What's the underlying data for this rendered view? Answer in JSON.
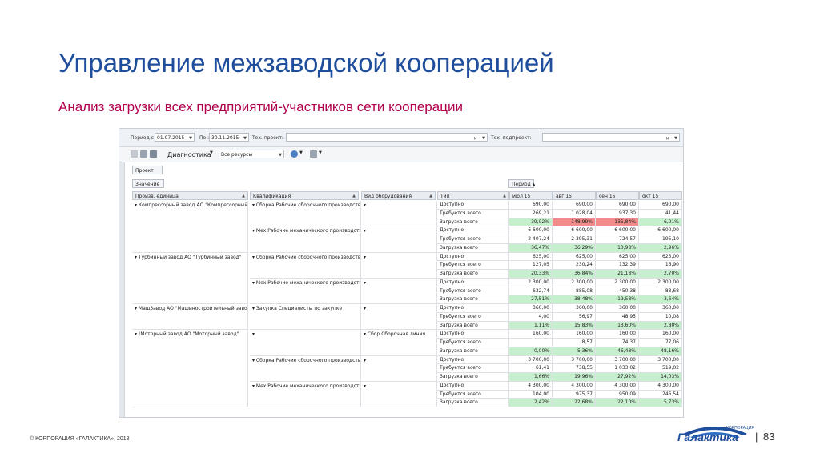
{
  "slide": {
    "title": "Управление межзаводской кооперацией",
    "subtitle": "Анализ загрузки всех предприятий-участников сети кооперации",
    "copyright": "© КОРПОРАЦИЯ «ГАЛАКТИКА», 2018",
    "page_number": "83",
    "separator": "|",
    "logo_text": "Галактика",
    "logo_small": "КОРПОРАЦИЯ"
  },
  "filters": {
    "period_from_label": "Период с :",
    "period_from_value": "01.07.2015",
    "period_to_label": "По :",
    "period_to_value": "30.11.2015",
    "project_label": "Тех. проект:",
    "project_value": "",
    "subproject_label": "Тех. подпроект:",
    "subproject_value": ""
  },
  "toolbar": {
    "view_label": "Диагностика",
    "resources_value": "Все ресурсы"
  },
  "areas": {
    "filter_area": "Проект",
    "data_area": "Значение",
    "column_area": "Период"
  },
  "columns": {
    "unit": "Произв. единица",
    "qualification": "Квалификация",
    "equipment": "Вид оборудования",
    "type": "Тип",
    "periods": [
      "июл 15",
      "авг 15",
      "сен 15",
      "окт 15"
    ]
  },
  "groups": [
    {
      "unit": "Компрессорный завод АО \"Компрессорный завод\"",
      "subgroups": [
        {
          "qual": "Сборка Рабочие сборочного производства",
          "equip": "",
          "rows": [
            {
              "type": "Доступно",
              "values": [
                "690,00",
                "690,00",
                "690,00",
                "690,00"
              ],
              "style": [
                "",
                "",
                "",
                ""
              ]
            },
            {
              "type": "Требуется всего",
              "values": [
                "269,21",
                "1 028,04",
                "937,30",
                "41,44"
              ],
              "style": [
                "",
                "",
                "",
                ""
              ]
            },
            {
              "type": "Загрузка всего",
              "values": [
                "39,02%",
                "148,99%",
                "135,84%",
                "6,01%"
              ],
              "style": [
                "green",
                "red",
                "red",
                "green"
              ]
            }
          ]
        },
        {
          "qual": "Мех Рабочие механического производства",
          "equip": "",
          "rows": [
            {
              "type": "Доступно",
              "values": [
                "6 600,00",
                "6 600,00",
                "6 600,00",
                "6 600,00"
              ],
              "style": [
                "",
                "",
                "",
                ""
              ]
            },
            {
              "type": "Требуется всего",
              "values": [
                "2 407,24",
                "2 395,31",
                "724,57",
                "195,10"
              ],
              "style": [
                "",
                "",
                "",
                ""
              ]
            },
            {
              "type": "Загрузка всего",
              "values": [
                "36,47%",
                "36,29%",
                "10,98%",
                "2,96%"
              ],
              "style": [
                "green",
                "green",
                "green",
                "green"
              ]
            }
          ]
        }
      ]
    },
    {
      "unit": "Турбинный завод АО \"Турбинный завод\"",
      "subgroups": [
        {
          "qual": "Сборка Рабочие сборочного производства",
          "equip": "",
          "rows": [
            {
              "type": "Доступно",
              "values": [
                "625,00",
                "625,00",
                "625,00",
                "625,00"
              ],
              "style": [
                "",
                "",
                "",
                ""
              ]
            },
            {
              "type": "Требуется всего",
              "values": [
                "127,05",
                "230,24",
                "132,39",
                "16,90"
              ],
              "style": [
                "",
                "",
                "",
                ""
              ]
            },
            {
              "type": "Загрузка всего",
              "values": [
                "20,33%",
                "36,84%",
                "21,18%",
                "2,70%"
              ],
              "style": [
                "green",
                "green",
                "green",
                "green"
              ]
            }
          ]
        },
        {
          "qual": "Мех Рабочие механического производства",
          "equip": "",
          "rows": [
            {
              "type": "Доступно",
              "values": [
                "2 300,00",
                "2 300,00",
                "2 300,00",
                "2 300,00"
              ],
              "style": [
                "",
                "",
                "",
                ""
              ]
            },
            {
              "type": "Требуется всего",
              "values": [
                "632,74",
                "885,08",
                "450,38",
                "83,68"
              ],
              "style": [
                "",
                "",
                "",
                ""
              ]
            },
            {
              "type": "Загрузка всего",
              "values": [
                "27,51%",
                "38,48%",
                "19,58%",
                "3,64%"
              ],
              "style": [
                "green",
                "green",
                "green",
                "green"
              ]
            }
          ]
        }
      ]
    },
    {
      "unit": "МашЗавод АО \"Машиностроительный завод\"",
      "subgroups": [
        {
          "qual": "Закупка Специалисты по закупке",
          "equip": "",
          "rows": [
            {
              "type": "Доступно",
              "values": [
                "360,00",
                "360,00",
                "360,00",
                "360,00"
              ],
              "style": [
                "",
                "",
                "",
                ""
              ]
            },
            {
              "type": "Требуется всего",
              "values": [
                "4,00",
                "56,97",
                "48,95",
                "10,08"
              ],
              "style": [
                "",
                "",
                "",
                ""
              ]
            },
            {
              "type": "Загрузка всего",
              "values": [
                "1,11%",
                "15,83%",
                "13,60%",
                "2,80%"
              ],
              "style": [
                "green",
                "green",
                "green",
                "green"
              ]
            }
          ]
        }
      ]
    },
    {
      "unit": "!Моторный завод АО \"Моторный завод\"",
      "subgroups": [
        {
          "qual": "",
          "equip": "Сбор Сборочная линия",
          "rows": [
            {
              "type": "Доступно",
              "values": [
                "160,00",
                "160,00",
                "160,00",
                "160,00"
              ],
              "style": [
                "",
                "",
                "",
                ""
              ]
            },
            {
              "type": "Требуется всего",
              "values": [
                "",
                "8,57",
                "74,37",
                "77,06"
              ],
              "style": [
                "",
                "",
                "",
                ""
              ]
            },
            {
              "type": "Загрузка всего",
              "values": [
                "0,00%",
                "5,36%",
                "46,48%",
                "48,16%"
              ],
              "style": [
                "green",
                "green",
                "green",
                "green"
              ]
            }
          ]
        },
        {
          "qual": "Сборка Рабочие сборочного производства",
          "equip": "",
          "rows": [
            {
              "type": "Доступно",
              "values": [
                "3 700,00",
                "3 700,00",
                "3 700,00",
                "3 700,00"
              ],
              "style": [
                "",
                "",
                "",
                ""
              ]
            },
            {
              "type": "Требуется всего",
              "values": [
                "61,41",
                "738,55",
                "1 033,02",
                "519,02"
              ],
              "style": [
                "",
                "",
                "",
                ""
              ]
            },
            {
              "type": "Загрузка всего",
              "values": [
                "1,66%",
                "19,96%",
                "27,92%",
                "14,03%"
              ],
              "style": [
                "green",
                "green",
                "green",
                "green"
              ]
            }
          ]
        },
        {
          "qual": "Мех Рабочие механического производства",
          "equip": "",
          "rows": [
            {
              "type": "Доступно",
              "values": [
                "4 300,00",
                "4 300,00",
                "4 300,00",
                "4 300,00"
              ],
              "style": [
                "",
                "",
                "",
                ""
              ]
            },
            {
              "type": "Требуется всего",
              "values": [
                "104,00",
                "975,37",
                "950,09",
                "246,54"
              ],
              "style": [
                "",
                "",
                "",
                ""
              ]
            },
            {
              "type": "Загрузка всего",
              "values": [
                "2,42%",
                "22,68%",
                "22,10%",
                "5,73%"
              ],
              "style": [
                "green",
                "green",
                "green",
                "green"
              ]
            }
          ]
        }
      ]
    }
  ],
  "colors": {
    "title": "#1f4e9c",
    "subtitle": "#b0004d",
    "ok": "#c6efce",
    "over": "#f28b8b"
  }
}
